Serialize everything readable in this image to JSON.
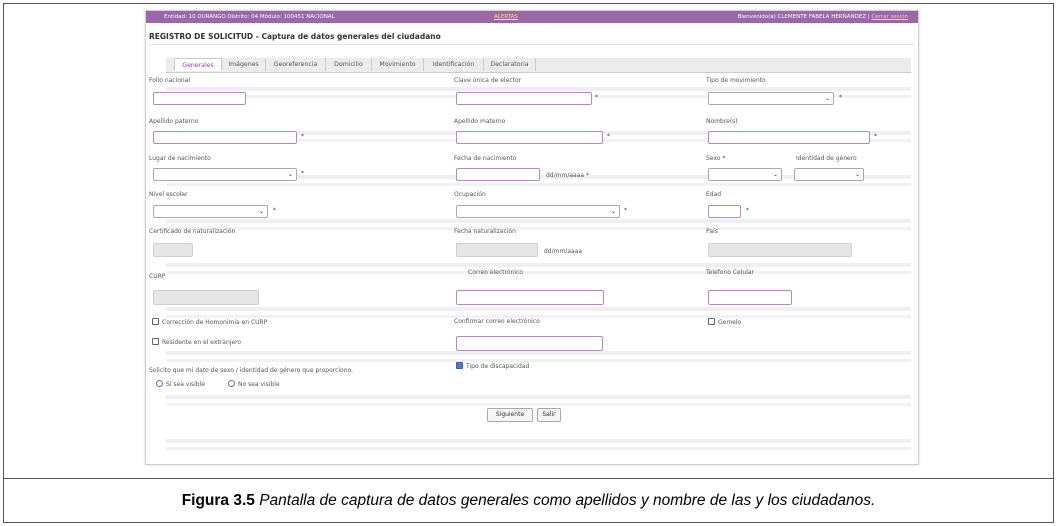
{
  "header": {
    "left": "Entidad: 10 DURANGO Distrito: 04 Módulo: 100451 NACIONAL",
    "center": "ALERTAS",
    "welcome": "Bienvenido(a) CLEMENTE FABELA HERNANDEZ",
    "logout": "Cerrar sesión"
  },
  "page_title": "REGISTRO DE SOLICITUD - Captura de datos generales del ciudadano",
  "tabs": [
    "Generales",
    "Imágenes",
    "Georeferencia",
    "Domicilio",
    "Movimiento",
    "Identificación",
    "Declaratoria"
  ],
  "active_tab": "Generales",
  "labels": {
    "folio": "Folio nacional",
    "clave": "Clave única de elector",
    "tipo_mov": "Tipo de movimiento",
    "ap_paterno": "Apellido paterno",
    "ap_materno": "Apellido materno",
    "nombres": "Nombre(s)",
    "lugar_nac": "Lugar de nacimiento",
    "fecha_nac": "Fecha de nacimiento",
    "fecha_fmt": "dd/mm/aaaa *",
    "sexo": "Sexo *",
    "identidad": "Identidad de género",
    "nivel": "Nivel escolar",
    "ocupacion": "Ocupación",
    "edad": "Edad",
    "certificado": "Certificado de naturalización",
    "fecha_natur": "Fecha naturalización",
    "fecha_natur_fmt": "dd/mm/aaaa",
    "pais": "País",
    "curp": "CURP",
    "correo": "Correo electrónico",
    "telefono": "Teléfono Celular",
    "homonimia": "Corrección de Homonimia en CURP",
    "confirmar_correo": "Confirmar correo electrónico",
    "gemelo": "Gemelo",
    "residente": "Residente en el extranjero",
    "solicito": "Solicito que mi dato de sexo / identidad de género que proporciono.",
    "discapacidad": "Tipo de discapacidad",
    "si_visible": "Sí sea visible",
    "no_visible": "No sea visible"
  },
  "required_mark": "*",
  "chevron": "⌄",
  "buttons": {
    "next": "Siguiente",
    "exit": "Salir"
  },
  "caption": {
    "bold": "Figura 3.5",
    "italic": " Pantalla de captura de datos generales como apellidos y nombre de las y los ciudadanos."
  }
}
